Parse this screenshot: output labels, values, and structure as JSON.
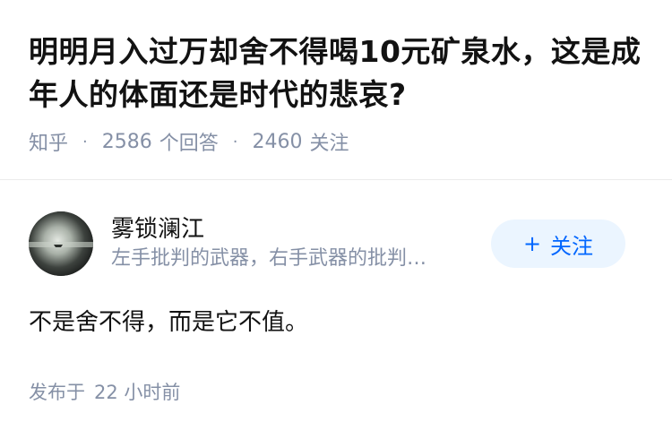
{
  "question": {
    "title": "明明月入过万却舍不得喝10元矿泉水，这是成年人的体面还是时代的悲哀?",
    "source": "知乎",
    "answer_count": "2586",
    "answer_label": "个回答",
    "follower_count": "2460",
    "follower_label": "关注"
  },
  "author": {
    "name": "雾锁澜江",
    "bio": "左手批判的武器，右手武器的批判…",
    "follow_plus": "+",
    "follow_label": "关注"
  },
  "answer": {
    "content": "不是舍不得，而是它不值。",
    "published_label": "发布于",
    "published_time": "22 小时前"
  },
  "colors": {
    "accent": "#0066ff",
    "follow_bg": "#ebf5ff",
    "meta_text": "#8590a6",
    "main_text": "#121212"
  }
}
